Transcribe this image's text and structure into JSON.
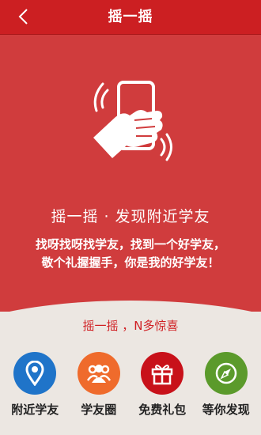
{
  "header": {
    "title": "摇一摇"
  },
  "hero": {
    "headline": "摇一摇 · 发现附近学友",
    "desc_line1": "找呀找呀找学友，找到一个好学友，",
    "desc_line2": "敬个礼握握手，你是我的好学友！"
  },
  "promo": "摇一摇 ，N多惊喜",
  "actions": [
    {
      "label": "附近学友",
      "icon": "location-pin-icon",
      "color": "#1f74c9"
    },
    {
      "label": "学友圈",
      "icon": "people-group-icon",
      "color": "#ef6b2c"
    },
    {
      "label": "免费礼包",
      "icon": "gift-icon",
      "color": "#c8111a"
    },
    {
      "label": "等你发现",
      "icon": "compass-icon",
      "color": "#5b9a2b"
    }
  ]
}
